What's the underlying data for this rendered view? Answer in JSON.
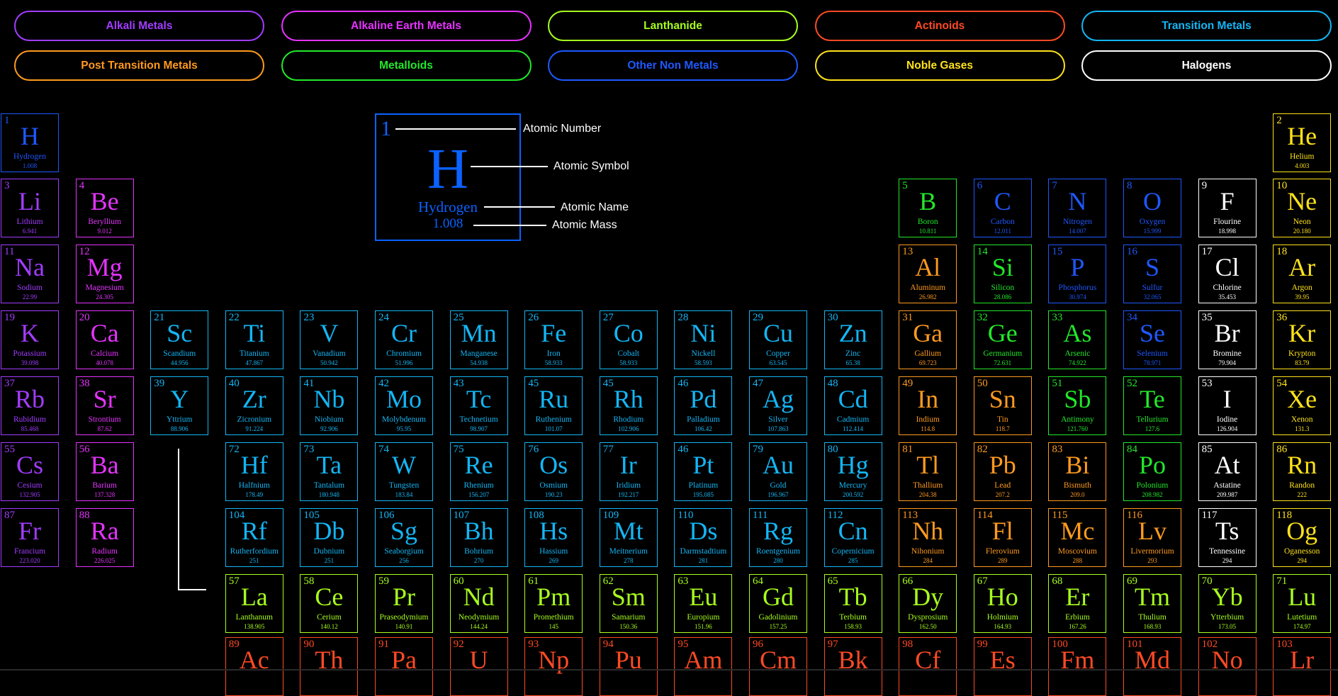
{
  "colors": {
    "alkali": "#a23cff",
    "alkaline": "#e633ff",
    "lanthanide": "#a8ff1e",
    "actinoid": "#ff4a24",
    "transition": "#13b6f5",
    "post_transition": "#ff9a1f",
    "metalloid": "#22e82a",
    "nonmetal": "#1f58ff",
    "noble": "#ffe21a",
    "halogen": "#ffffff"
  },
  "categories": [
    {
      "label": "Alkali Metals",
      "color": "alkali"
    },
    {
      "label": "Alkaline Earth Metals",
      "color": "alkaline"
    },
    {
      "label": "Lanthanide",
      "color": "lanthanide"
    },
    {
      "label": "Actinoids",
      "color": "actinoid"
    },
    {
      "label": "Transition Metals",
      "color": "transition"
    },
    {
      "label": "Post Transition Metals",
      "color": "post_transition"
    },
    {
      "label": "Metalloids",
      "color": "metalloid"
    },
    {
      "label": "Other Non Metals",
      "color": "nonmetal"
    },
    {
      "label": "Noble Gases",
      "color": "noble"
    },
    {
      "label": "Halogens",
      "color": "halogen"
    }
  ],
  "legend": {
    "number": "1",
    "symbol": "H",
    "name": "Hydrogen",
    "mass": "1.008",
    "labels": {
      "number": "Atomic Number",
      "symbol": "Atomic Symbol",
      "name": "Atomic Name",
      "mass": "Atomic Mass"
    }
  },
  "elements": [
    {
      "n": "1",
      "s": "H",
      "name": "Hydrogen",
      "m": "1.008",
      "c": "nonmetal",
      "row": 1,
      "col": 1
    },
    {
      "n": "2",
      "s": "He",
      "name": "Helium",
      "m": "4.003",
      "c": "noble",
      "row": 1,
      "col": 18
    },
    {
      "n": "3",
      "s": "Li",
      "name": "Lithium",
      "m": "6.941",
      "c": "alkali",
      "row": 2,
      "col": 1
    },
    {
      "n": "4",
      "s": "Be",
      "name": "Beryllium",
      "m": "9.012",
      "c": "alkaline",
      "row": 2,
      "col": 2
    },
    {
      "n": "5",
      "s": "B",
      "name": "Boron",
      "m": "10.811",
      "c": "metalloid",
      "row": 2,
      "col": 13
    },
    {
      "n": "6",
      "s": "C",
      "name": "Carbon",
      "m": "12.011",
      "c": "nonmetal",
      "row": 2,
      "col": 14
    },
    {
      "n": "7",
      "s": "N",
      "name": "Nitrogen",
      "m": "14.007",
      "c": "nonmetal",
      "row": 2,
      "col": 15
    },
    {
      "n": "8",
      "s": "O",
      "name": "Oxygen",
      "m": "15.999",
      "c": "nonmetal",
      "row": 2,
      "col": 16
    },
    {
      "n": "9",
      "s": "F",
      "name": "Flourine",
      "m": "18.998",
      "c": "halogen",
      "row": 2,
      "col": 17
    },
    {
      "n": "10",
      "s": "Ne",
      "name": "Neon",
      "m": "20.180",
      "c": "noble",
      "row": 2,
      "col": 18
    },
    {
      "n": "11",
      "s": "Na",
      "name": "Sodium",
      "m": "22.99",
      "c": "alkali",
      "row": 3,
      "col": 1
    },
    {
      "n": "12",
      "s": "Mg",
      "name": "Magnesium",
      "m": "24.305",
      "c": "alkaline",
      "row": 3,
      "col": 2
    },
    {
      "n": "13",
      "s": "Al",
      "name": "Aluminum",
      "m": "26.982",
      "c": "post_transition",
      "row": 3,
      "col": 13
    },
    {
      "n": "14",
      "s": "Si",
      "name": "Silicon",
      "m": "28.086",
      "c": "metalloid",
      "row": 3,
      "col": 14
    },
    {
      "n": "15",
      "s": "P",
      "name": "Phosphorus",
      "m": "30.974",
      "c": "nonmetal",
      "row": 3,
      "col": 15
    },
    {
      "n": "16",
      "s": "S",
      "name": "Sulfur",
      "m": "32.065",
      "c": "nonmetal",
      "row": 3,
      "col": 16
    },
    {
      "n": "17",
      "s": "Cl",
      "name": "Chlorine",
      "m": "35.453",
      "c": "halogen",
      "row": 3,
      "col": 17
    },
    {
      "n": "18",
      "s": "Ar",
      "name": "Argon",
      "m": "39.95",
      "c": "noble",
      "row": 3,
      "col": 18
    },
    {
      "n": "19",
      "s": "K",
      "name": "Potassium",
      "m": "39.098",
      "c": "alkali",
      "row": 4,
      "col": 1
    },
    {
      "n": "20",
      "s": "Ca",
      "name": "Calcium",
      "m": "40.078",
      "c": "alkaline",
      "row": 4,
      "col": 2
    },
    {
      "n": "21",
      "s": "Sc",
      "name": "Scandium",
      "m": "44.956",
      "c": "transition",
      "row": 4,
      "col": 3
    },
    {
      "n": "22",
      "s": "Ti",
      "name": "Titanium",
      "m": "47.867",
      "c": "transition",
      "row": 4,
      "col": 4
    },
    {
      "n": "23",
      "s": "V",
      "name": "Vanadium",
      "m": "50.942",
      "c": "transition",
      "row": 4,
      "col": 5
    },
    {
      "n": "24",
      "s": "Cr",
      "name": "Chromium",
      "m": "51.996",
      "c": "transition",
      "row": 4,
      "col": 6
    },
    {
      "n": "25",
      "s": "Mn",
      "name": "Manganese",
      "m": "54.938",
      "c": "transition",
      "row": 4,
      "col": 7
    },
    {
      "n": "26",
      "s": "Fe",
      "name": "Iron",
      "m": "58.933",
      "c": "transition",
      "row": 4,
      "col": 8
    },
    {
      "n": "27",
      "s": "Co",
      "name": "Cobalt",
      "m": "58.933",
      "c": "transition",
      "row": 4,
      "col": 9
    },
    {
      "n": "28",
      "s": "Ni",
      "name": "Nickell",
      "m": "58.593",
      "c": "transition",
      "row": 4,
      "col": 10
    },
    {
      "n": "29",
      "s": "Cu",
      "name": "Copper",
      "m": "63.545",
      "c": "transition",
      "row": 4,
      "col": 11
    },
    {
      "n": "30",
      "s": "Zn",
      "name": "Zinc",
      "m": "65.38",
      "c": "transition",
      "row": 4,
      "col": 12
    },
    {
      "n": "31",
      "s": "Ga",
      "name": "Gallium",
      "m": "69.723",
      "c": "post_transition",
      "row": 4,
      "col": 13
    },
    {
      "n": "32",
      "s": "Ge",
      "name": "Germanium",
      "m": "72.631",
      "c": "metalloid",
      "row": 4,
      "col": 14
    },
    {
      "n": "33",
      "s": "As",
      "name": "Arsenic",
      "m": "74.922",
      "c": "metalloid",
      "row": 4,
      "col": 15
    },
    {
      "n": "34",
      "s": "Se",
      "name": "Selenium",
      "m": "78.971",
      "c": "nonmetal",
      "row": 4,
      "col": 16
    },
    {
      "n": "35",
      "s": "Br",
      "name": "Bromine",
      "m": "79.904",
      "c": "halogen",
      "row": 4,
      "col": 17
    },
    {
      "n": "36",
      "s": "Kr",
      "name": "Krypton",
      "m": "83.79",
      "c": "noble",
      "row": 4,
      "col": 18
    },
    {
      "n": "37",
      "s": "Rb",
      "name": "Rubidium",
      "m": "85.468",
      "c": "alkali",
      "row": 5,
      "col": 1
    },
    {
      "n": "38",
      "s": "Sr",
      "name": "Strontium",
      "m": "87.62",
      "c": "alkaline",
      "row": 5,
      "col": 2
    },
    {
      "n": "39",
      "s": "Y",
      "name": "Yttrium",
      "m": "88.906",
      "c": "transition",
      "row": 5,
      "col": 3
    },
    {
      "n": "40",
      "s": "Zr",
      "name": "Zicronium",
      "m": "91.224",
      "c": "transition",
      "row": 5,
      "col": 4
    },
    {
      "n": "41",
      "s": "Nb",
      "name": "Niobium",
      "m": "92.906",
      "c": "transition",
      "row": 5,
      "col": 5
    },
    {
      "n": "42",
      "s": "Mo",
      "name": "Molybdenum",
      "m": "95.95",
      "c": "transition",
      "row": 5,
      "col": 6
    },
    {
      "n": "43",
      "s": "Tc",
      "name": "Technetium",
      "m": "98.907",
      "c": "transition",
      "row": 5,
      "col": 7
    },
    {
      "n": "45",
      "s": "Ru",
      "name": "Ruthenium",
      "m": "101.07",
      "c": "transition",
      "row": 5,
      "col": 8
    },
    {
      "n": "45",
      "s": "Rh",
      "name": "Rhodium",
      "m": "102.906",
      "c": "transition",
      "row": 5,
      "col": 9
    },
    {
      "n": "46",
      "s": "Pd",
      "name": "Palladium",
      "m": "106.42",
      "c": "transition",
      "row": 5,
      "col": 10
    },
    {
      "n": "47",
      "s": "Ag",
      "name": "Silver",
      "m": "107.863",
      "c": "transition",
      "row": 5,
      "col": 11
    },
    {
      "n": "48",
      "s": "Cd",
      "name": "Cadmium",
      "m": "112.414",
      "c": "transition",
      "row": 5,
      "col": 12
    },
    {
      "n": "49",
      "s": "In",
      "name": "Indium",
      "m": "114.8",
      "c": "post_transition",
      "row": 5,
      "col": 13
    },
    {
      "n": "50",
      "s": "Sn",
      "name": "Tin",
      "m": "118.7",
      "c": "post_transition",
      "row": 5,
      "col": 14
    },
    {
      "n": "51",
      "s": "Sb",
      "name": "Antimony",
      "m": "121.760",
      "c": "metalloid",
      "row": 5,
      "col": 15
    },
    {
      "n": "52",
      "s": "Te",
      "name": "Tellurium",
      "m": "127.6",
      "c": "metalloid",
      "row": 5,
      "col": 16
    },
    {
      "n": "53",
      "s": "I",
      "name": "Iodine",
      "m": "126.904",
      "c": "halogen",
      "row": 5,
      "col": 17
    },
    {
      "n": "54",
      "s": "Xe",
      "name": "Xenon",
      "m": "131.3",
      "c": "noble",
      "row": 5,
      "col": 18
    },
    {
      "n": "55",
      "s": "Cs",
      "name": "Cesium",
      "m": "132.905",
      "c": "alkali",
      "row": 6,
      "col": 1
    },
    {
      "n": "56",
      "s": "Ba",
      "name": "Barium",
      "m": "137.328",
      "c": "alkaline",
      "row": 6,
      "col": 2
    },
    {
      "n": "72",
      "s": "Hf",
      "name": "Halfnium",
      "m": "178.49",
      "c": "transition",
      "row": 6,
      "col": 4
    },
    {
      "n": "73",
      "s": "Ta",
      "name": "Tantalum",
      "m": "180.948",
      "c": "transition",
      "row": 6,
      "col": 5
    },
    {
      "n": "74",
      "s": "W",
      "name": "Tungsten",
      "m": "183.84",
      "c": "transition",
      "row": 6,
      "col": 6
    },
    {
      "n": "75",
      "s": "Re",
      "name": "Rhenium",
      "m": "156.207",
      "c": "transition",
      "row": 6,
      "col": 7
    },
    {
      "n": "76",
      "s": "Os",
      "name": "Osmium",
      "m": "190.23",
      "c": "transition",
      "row": 6,
      "col": 8
    },
    {
      "n": "77",
      "s": "Ir",
      "name": "Iridium",
      "m": "192.217",
      "c": "transition",
      "row": 6,
      "col": 9
    },
    {
      "n": "46",
      "s": "Pt",
      "name": "Platinum",
      "m": "195.085",
      "c": "transition",
      "row": 6,
      "col": 10
    },
    {
      "n": "79",
      "s": "Au",
      "name": "Gold",
      "m": "196.967",
      "c": "transition",
      "row": 6,
      "col": 11
    },
    {
      "n": "80",
      "s": "Hg",
      "name": "Mercury",
      "m": "200.592",
      "c": "transition",
      "row": 6,
      "col": 12
    },
    {
      "n": "81",
      "s": "Tl",
      "name": "Thallium",
      "m": "204.38",
      "c": "post_transition",
      "row": 6,
      "col": 13
    },
    {
      "n": "82",
      "s": "Pb",
      "name": "Lead",
      "m": "207.2",
      "c": "post_transition",
      "row": 6,
      "col": 14
    },
    {
      "n": "83",
      "s": "Bi",
      "name": "Bismuth",
      "m": "209.0",
      "c": "post_transition",
      "row": 6,
      "col": 15
    },
    {
      "n": "84",
      "s": "Po",
      "name": "Polonium",
      "m": "208.982",
      "c": "metalloid",
      "row": 6,
      "col": 16
    },
    {
      "n": "85",
      "s": "At",
      "name": "Astatine",
      "m": "209.987",
      "c": "halogen",
      "row": 6,
      "col": 17
    },
    {
      "n": "86",
      "s": "Rn",
      "name": "Randon",
      "m": "222",
      "c": "noble",
      "row": 6,
      "col": 18
    },
    {
      "n": "87",
      "s": "Fr",
      "name": "Francium",
      "m": "223.020",
      "c": "alkali",
      "row": 7,
      "col": 1
    },
    {
      "n": "88",
      "s": "Ra",
      "name": "Radium",
      "m": "226.025",
      "c": "alkaline",
      "row": 7,
      "col": 2
    },
    {
      "n": "104",
      "s": "Rf",
      "name": "Rutherfordium",
      "m": "251",
      "c": "transition",
      "row": 7,
      "col": 4
    },
    {
      "n": "105",
      "s": "Db",
      "name": "Dubnium",
      "m": "251",
      "c": "transition",
      "row": 7,
      "col": 5
    },
    {
      "n": "106",
      "s": "Sg",
      "name": "Seaborgium",
      "m": "256",
      "c": "transition",
      "row": 7,
      "col": 6
    },
    {
      "n": "107",
      "s": "Bh",
      "name": "Bohrium",
      "m": "270",
      "c": "transition",
      "row": 7,
      "col": 7
    },
    {
      "n": "108",
      "s": "Hs",
      "name": "Hassium",
      "m": "269",
      "c": "transition",
      "row": 7,
      "col": 8
    },
    {
      "n": "109",
      "s": "Mt",
      "name": "Meitnerium",
      "m": "278",
      "c": "transition",
      "row": 7,
      "col": 9
    },
    {
      "n": "110",
      "s": "Ds",
      "name": "Darmstadtium",
      "m": "281",
      "c": "transition",
      "row": 7,
      "col": 10
    },
    {
      "n": "111",
      "s": "Rg",
      "name": "Roentgenium",
      "m": "280",
      "c": "transition",
      "row": 7,
      "col": 11
    },
    {
      "n": "112",
      "s": "Cn",
      "name": "Copernicium",
      "m": "285",
      "c": "transition",
      "row": 7,
      "col": 12
    },
    {
      "n": "113",
      "s": "Nh",
      "name": "Nihonium",
      "m": "284",
      "c": "post_transition",
      "row": 7,
      "col": 13
    },
    {
      "n": "114",
      "s": "Fl",
      "name": "Flerovium",
      "m": "289",
      "c": "post_transition",
      "row": 7,
      "col": 14
    },
    {
      "n": "115",
      "s": "Mc",
      "name": "Moscovium",
      "m": "288",
      "c": "post_transition",
      "row": 7,
      "col": 15
    },
    {
      "n": "116",
      "s": "Lv",
      "name": "Livermorium",
      "m": "293",
      "c": "post_transition",
      "row": 7,
      "col": 16
    },
    {
      "n": "117",
      "s": "Ts",
      "name": "Tennessine",
      "m": "294",
      "c": "halogen",
      "row": 7,
      "col": 17
    },
    {
      "n": "118",
      "s": "Og",
      "name": "Oganesson",
      "m": "294",
      "c": "noble",
      "row": 7,
      "col": 18
    },
    {
      "n": "57",
      "s": "La",
      "name": "Lanthanum",
      "m": "138.905",
      "c": "lanthanide",
      "row": 8,
      "col": 4
    },
    {
      "n": "58",
      "s": "Ce",
      "name": "Cerium",
      "m": "140.12",
      "c": "lanthanide",
      "row": 8,
      "col": 5
    },
    {
      "n": "59",
      "s": "Pr",
      "name": "Praseodymium",
      "m": "140.91",
      "c": "lanthanide",
      "row": 8,
      "col": 6
    },
    {
      "n": "60",
      "s": "Nd",
      "name": "Neodymium",
      "m": "144.24",
      "c": "lanthanide",
      "row": 8,
      "col": 7
    },
    {
      "n": "61",
      "s": "Pm",
      "name": "Promethium",
      "m": "145",
      "c": "lanthanide",
      "row": 8,
      "col": 8
    },
    {
      "n": "62",
      "s": "Sm",
      "name": "Samarium",
      "m": "150.36",
      "c": "lanthanide",
      "row": 8,
      "col": 9
    },
    {
      "n": "63",
      "s": "Eu",
      "name": "Europium",
      "m": "151.96",
      "c": "lanthanide",
      "row": 8,
      "col": 10
    },
    {
      "n": "64",
      "s": "Gd",
      "name": "Gadolinium",
      "m": "157.25",
      "c": "lanthanide",
      "row": 8,
      "col": 11
    },
    {
      "n": "65",
      "s": "Tb",
      "name": "Terbium",
      "m": "158.93",
      "c": "lanthanide",
      "row": 8,
      "col": 12
    },
    {
      "n": "66",
      "s": "Dy",
      "name": "Dysprosium",
      "m": "162.50",
      "c": "lanthanide",
      "row": 8,
      "col": 13
    },
    {
      "n": "67",
      "s": "Ho",
      "name": "Holmium",
      "m": "164.93",
      "c": "lanthanide",
      "row": 8,
      "col": 14
    },
    {
      "n": "68",
      "s": "Er",
      "name": "Erbium",
      "m": "167.26",
      "c": "lanthanide",
      "row": 8,
      "col": 15
    },
    {
      "n": "69",
      "s": "Tm",
      "name": "Thulium",
      "m": "168.93",
      "c": "lanthanide",
      "row": 8,
      "col": 16
    },
    {
      "n": "70",
      "s": "Yb",
      "name": "Ytterbium",
      "m": "173.05",
      "c": "lanthanide",
      "row": 8,
      "col": 17
    },
    {
      "n": "71",
      "s": "Lu",
      "name": "Lutetium",
      "m": "174.97",
      "c": "lanthanide",
      "row": 8,
      "col": 18
    },
    {
      "n": "89",
      "s": "Ac",
      "name": "",
      "m": "",
      "c": "actinoid",
      "row": 9,
      "col": 4
    },
    {
      "n": "90",
      "s": "Th",
      "name": "",
      "m": "",
      "c": "actinoid",
      "row": 9,
      "col": 5
    },
    {
      "n": "91",
      "s": "Pa",
      "name": "",
      "m": "",
      "c": "actinoid",
      "row": 9,
      "col": 6
    },
    {
      "n": "92",
      "s": "U",
      "name": "",
      "m": "",
      "c": "actinoid",
      "row": 9,
      "col": 7
    },
    {
      "n": "93",
      "s": "Np",
      "name": "",
      "m": "",
      "c": "actinoid",
      "row": 9,
      "col": 8
    },
    {
      "n": "94",
      "s": "Pu",
      "name": "",
      "m": "",
      "c": "actinoid",
      "row": 9,
      "col": 9
    },
    {
      "n": "95",
      "s": "Am",
      "name": "",
      "m": "",
      "c": "actinoid",
      "row": 9,
      "col": 10
    },
    {
      "n": "96",
      "s": "Cm",
      "name": "",
      "m": "",
      "c": "actinoid",
      "row": 9,
      "col": 11
    },
    {
      "n": "97",
      "s": "Bk",
      "name": "",
      "m": "",
      "c": "actinoid",
      "row": 9,
      "col": 12
    },
    {
      "n": "98",
      "s": "Cf",
      "name": "",
      "m": "",
      "c": "actinoid",
      "row": 9,
      "col": 13
    },
    {
      "n": "99",
      "s": "Es",
      "name": "",
      "m": "",
      "c": "actinoid",
      "row": 9,
      "col": 14
    },
    {
      "n": "100",
      "s": "Fm",
      "name": "",
      "m": "",
      "c": "actinoid",
      "row": 9,
      "col": 15
    },
    {
      "n": "101",
      "s": "Md",
      "name": "",
      "m": "",
      "c": "actinoid",
      "row": 9,
      "col": 16
    },
    {
      "n": "102",
      "s": "No",
      "name": "",
      "m": "",
      "c": "actinoid",
      "row": 9,
      "col": 17
    },
    {
      "n": "103",
      "s": "Lr",
      "name": "",
      "m": "",
      "c": "actinoid",
      "row": 9,
      "col": 18
    }
  ]
}
